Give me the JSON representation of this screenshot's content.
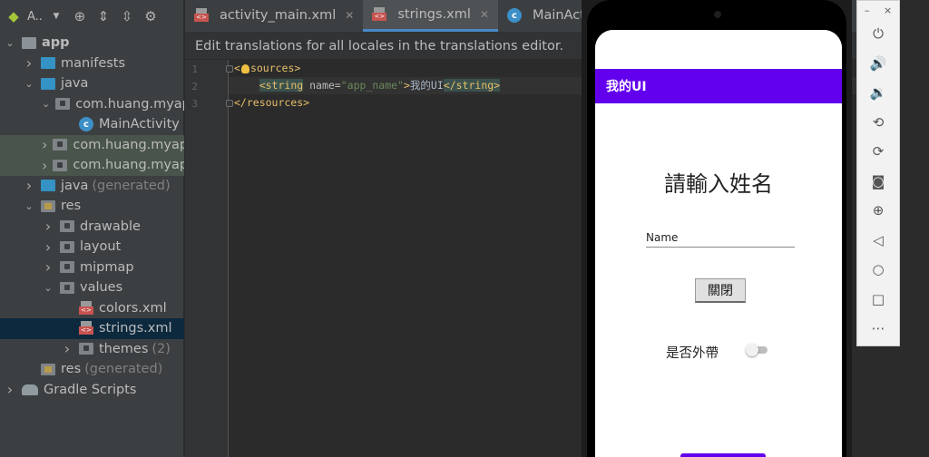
{
  "project": {
    "toolbar_title": "A..",
    "tree": [
      {
        "label": "app",
        "indent": 0,
        "arrow": "▾",
        "icon": "module"
      },
      {
        "label": "manifests",
        "indent": 1,
        "arrow": "›",
        "icon": "folder"
      },
      {
        "label": "java",
        "indent": 1,
        "arrow": "▾",
        "icon": "folder"
      },
      {
        "label": "com.huang.myap",
        "indent": 2,
        "arrow": "▾",
        "icon": "package"
      },
      {
        "label": "MainActivity",
        "indent": 3,
        "arrow": "",
        "icon": "class"
      },
      {
        "label": "com.huang.myap",
        "indent": 2,
        "arrow": "›",
        "icon": "package"
      },
      {
        "label": "com.huang.myap",
        "indent": 2,
        "arrow": "›",
        "icon": "package"
      },
      {
        "label": "java",
        "suffix": "(generated)",
        "indent": 1,
        "arrow": "›",
        "icon": "folder-gen"
      },
      {
        "label": "res",
        "indent": 1,
        "arrow": "▾",
        "icon": "res"
      },
      {
        "label": "drawable",
        "indent": 2,
        "arrow": "›",
        "icon": "folder-gray"
      },
      {
        "label": "layout",
        "indent": 2,
        "arrow": "›",
        "icon": "folder-gray"
      },
      {
        "label": "mipmap",
        "indent": 2,
        "arrow": "›",
        "icon": "folder-gray"
      },
      {
        "label": "values",
        "indent": 2,
        "arrow": "▾",
        "icon": "folder-gray"
      },
      {
        "label": "colors.xml",
        "indent": 3,
        "arrow": "",
        "icon": "xml"
      },
      {
        "label": "strings.xml",
        "indent": 3,
        "arrow": "",
        "icon": "xml"
      },
      {
        "label": "themes",
        "suffix": "(2)",
        "indent": 3,
        "arrow": "›",
        "icon": "folder-gray"
      },
      {
        "label": "res",
        "suffix": "(generated)",
        "indent": 1,
        "arrow": "",
        "icon": "res"
      },
      {
        "label": "Gradle Scripts",
        "indent": 0,
        "arrow": "›",
        "icon": "gradle"
      }
    ]
  },
  "tabs": [
    {
      "label": "activity_main.xml",
      "icon": "xml"
    },
    {
      "label": "strings.xml",
      "icon": "xml"
    },
    {
      "label": "MainActivity.java",
      "icon": "class"
    }
  ],
  "banner": "Edit translations for all locales in the translations editor.",
  "code": {
    "line_numbers": [
      "1",
      "2",
      "3"
    ],
    "line1_tag": "sources",
    "line2_open": "<string",
    "line2_attr": "name=",
    "line2_value": "\"app_name\"",
    "line2_text": "我的UI",
    "line2_close": "</string>",
    "line3": "</resources>"
  },
  "app": {
    "title": "我的UI",
    "heading": "請輸入姓名",
    "name_placeholder": "Name",
    "close_button": "關閉",
    "takeout_label": "是否外帶",
    "accent": "#6200ee"
  },
  "emulator_toolbar": {
    "minimize": "–",
    "close": "×",
    "buttons": [
      "power-icon",
      "volume-up-icon",
      "volume-down-icon",
      "rotate-left-icon",
      "rotate-right-icon",
      "camera-icon",
      "zoom-icon",
      "back-icon",
      "home-icon",
      "overview-icon",
      "more-icon"
    ]
  }
}
